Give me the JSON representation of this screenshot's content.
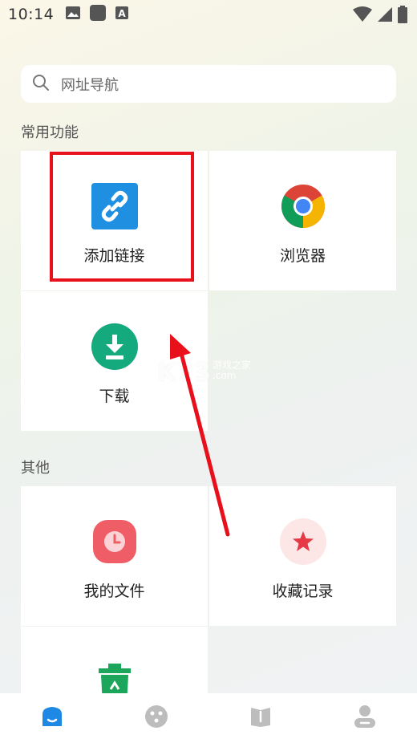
{
  "status_bar": {
    "time": "10:14",
    "icons_left": [
      "image-icon",
      "app-square-icon",
      "font-a-icon"
    ],
    "icons_right": [
      "wifi-icon",
      "signal-icon",
      "battery-icon"
    ]
  },
  "search": {
    "placeholder": "网址导航"
  },
  "sections": {
    "common": "常用功能",
    "other": "其他"
  },
  "tiles": {
    "add_link": "添加链接",
    "browser": "浏览器",
    "download": "下载",
    "my_files": "我的文件",
    "favorites": "收藏记录"
  },
  "watermark": {
    "main": "K73",
    "sub_top": "游戏之家",
    "sub_bottom": ".com"
  },
  "colors": {
    "accent_blue": "#1e88e5",
    "link_icon_bg": "#1e8fe1",
    "download_green": "#15a97e",
    "files_red": "#ef5d67",
    "favorites_red": "#e53945",
    "favorites_bg": "#fde6e6",
    "trash_green": "#1ba65b",
    "annotation_red": "#e8101a"
  },
  "bottom_nav": [
    "home-icon",
    "discover-icon",
    "book-icon",
    "profile-icon"
  ]
}
